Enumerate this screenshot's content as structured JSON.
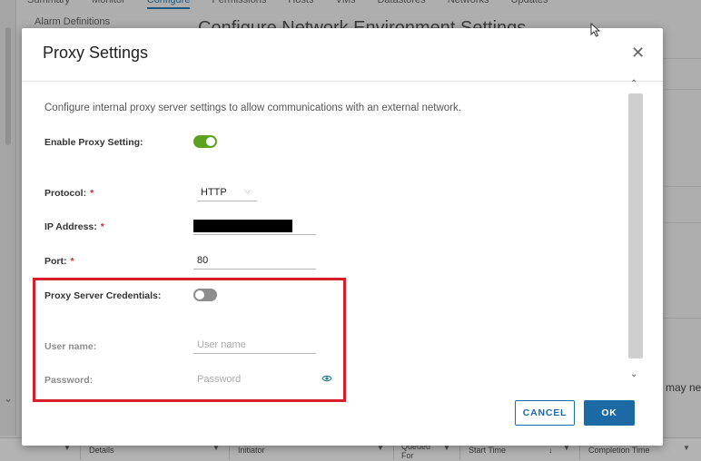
{
  "background": {
    "tabs": [
      "Summary",
      "Monitor",
      "Configure",
      "Permissions",
      "Hosts",
      "VMs",
      "Datastores",
      "Networks",
      "Updates"
    ],
    "active_tab": "Configure",
    "sub_item": "Alarm Definitions",
    "heading": "Configure Network Environment Settings",
    "right_text": "may nega",
    "table_columns": [
      "Details",
      "Initiator",
      "Queued For",
      "Start Time",
      "Completion Time"
    ]
  },
  "dialog": {
    "title": "Proxy Settings",
    "close_icon": "close-icon",
    "description": "Configure internal proxy server settings to allow communications with an external network.",
    "enable_proxy": {
      "label": "Enable Proxy Setting:",
      "enabled": true
    },
    "protocol": {
      "label": "Protocol:",
      "required": "*",
      "value": "HTTP"
    },
    "ip_address": {
      "label": "IP Address:",
      "required": "*",
      "value": ""
    },
    "port": {
      "label": "Port:",
      "required": "*",
      "value": "80"
    },
    "credentials": {
      "label": "Proxy Server Credentials:",
      "enabled": false
    },
    "username": {
      "label": "User name:",
      "placeholder": "User name"
    },
    "password": {
      "label": "Password:",
      "placeholder": "Password"
    },
    "buttons": {
      "cancel": "CANCEL",
      "ok": "OK"
    }
  },
  "colors": {
    "accent": "#1b6aa3",
    "toggle_on": "#5aa220",
    "toggle_off": "#8d8d8d",
    "highlight": "#d81e2a",
    "required": "#d0262e"
  }
}
